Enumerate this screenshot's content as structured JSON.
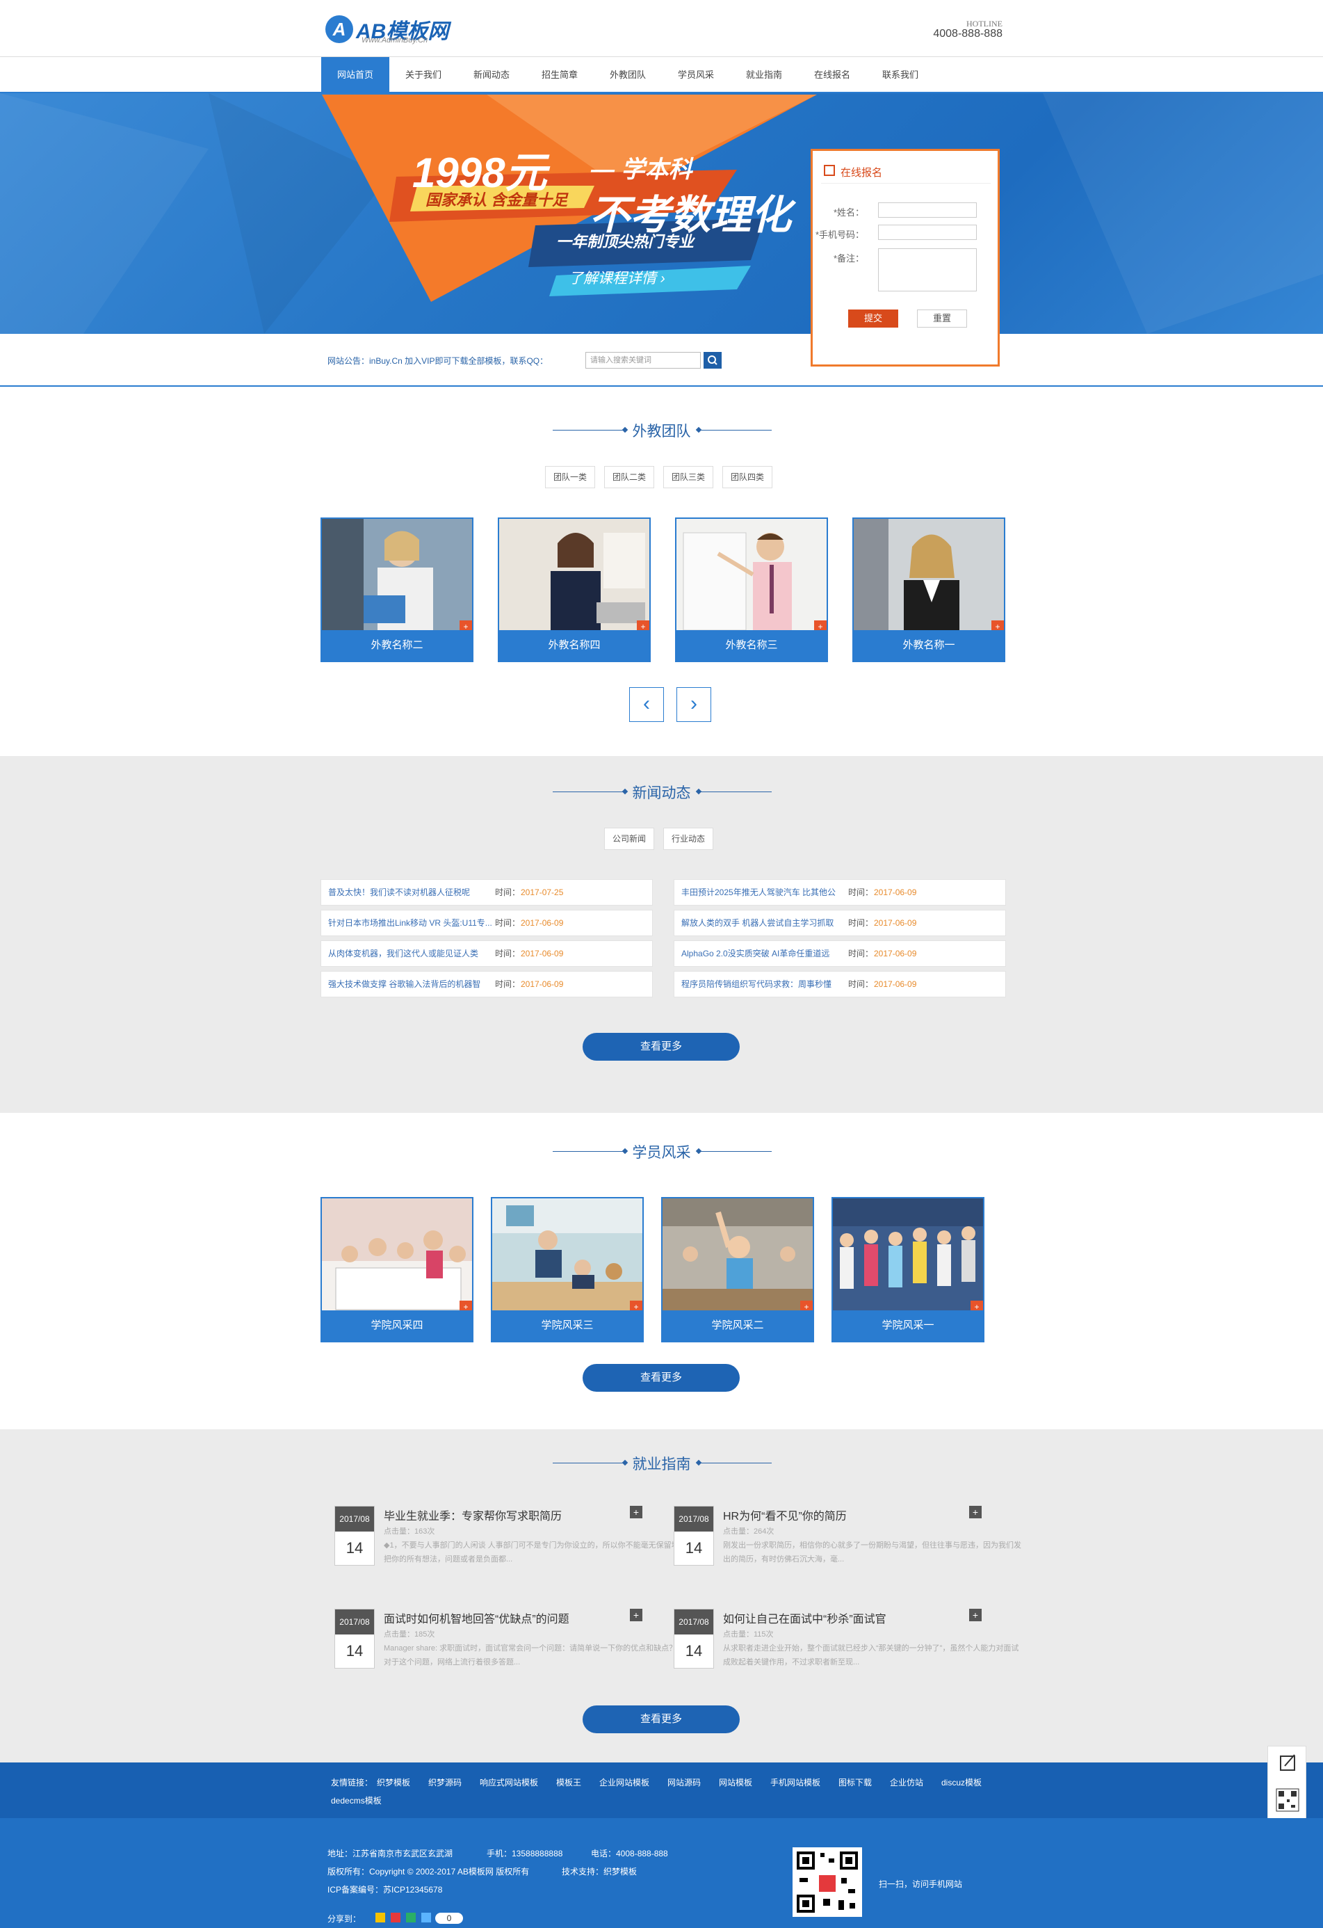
{
  "header": {
    "logo_mark": "A",
    "logo_text": "AB模板网",
    "logo_sub": "Www.AdminBuy.Cn",
    "hotline_label": "HOTLINE",
    "hotline_number": "4008-888-888"
  },
  "nav": {
    "items": [
      "网站首页",
      "关于我们",
      "新闻动态",
      "招生简章",
      "外教团队",
      "学员风采",
      "就业指南",
      "在线报名",
      "联系我们"
    ],
    "active_index": 0
  },
  "banner": {
    "title": "1998元",
    "title_suffix": "— 学本科",
    "tag": "国家承认  含金量十足",
    "headline": "不考数理化",
    "band": "一年制顶尖热门专业",
    "more": "了解课程详情 ›"
  },
  "signup_form": {
    "title": "在线报名",
    "name_label": "*姓名：",
    "phone_label": "*手机号码：",
    "note_label": "*备注：",
    "submit_label": "提交",
    "reset_label": "重置"
  },
  "notice": {
    "text": "网站公告：inBuy.Cn 加入VIP即可下载全部模板，联系QQ：",
    "search_placeholder": "请输入搜索关键词"
  },
  "teachers": {
    "title": "外教团队",
    "tabs": [
      "团队一类",
      "团队二类",
      "团队三类",
      "团队四类"
    ],
    "cards": [
      "外教名称二",
      "外教名称四",
      "外教名称三",
      "外教名称一"
    ],
    "prev_label": "‹",
    "next_label": "›"
  },
  "news": {
    "title": "新闻动态",
    "tabs": [
      "公司新闻",
      "行业动态"
    ],
    "time_label": "时间：",
    "left": [
      {
        "title": "普及太快！我们读不读对机器人征税呢",
        "date": "2017-07-25"
      },
      {
        "title": "针对日本市场推出Link移动 VR 头盔:U11专...",
        "date": "2017-06-09"
      },
      {
        "title": "从肉体变机器，我们这代人或能见证人类",
        "date": "2017-06-09"
      },
      {
        "title": "强大技术做支撑 谷歌输入法背后的机器智",
        "date": "2017-06-09"
      }
    ],
    "right": [
      {
        "title": "丰田预计2025年推无人驾驶汽车 比其他公",
        "date": "2017-06-09"
      },
      {
        "title": "解放人类的双手 机器人尝试自主学习抓取",
        "date": "2017-06-09"
      },
      {
        "title": "AlphaGo 2.0没实质突破 AI革命任重道远",
        "date": "2017-06-09"
      },
      {
        "title": "程序员陪传销组织写代码求救：周事秒懂",
        "date": "2017-06-09"
      }
    ],
    "more_label": "查看更多"
  },
  "students": {
    "title": "学员风采",
    "cards": [
      "学院风采四",
      "学院风采三",
      "学院风采二",
      "学院风采一"
    ],
    "more_label": "查看更多"
  },
  "guide": {
    "title": "就业指南",
    "items": [
      {
        "ym": "2017/08",
        "day": "14",
        "title": "毕业生就业季：专家帮你写求职简历",
        "views": "点击量：163次",
        "desc": "◆1，不要与人事部门的人闲谈 人事部门可不是专门为你设立的，所以你不能毫无保留地把你的所有想法，问题或者是负面都..."
      },
      {
        "ym": "2017/08",
        "day": "14",
        "title": "HR为何“看不见”你的简历",
        "views": "点击量：264次",
        "desc": "刚发出一份求职简历，相信你的心就多了一份期盼与渴望，但往往事与愿违，因为我们发出的简历，有时仿佛石沉大海，毫..."
      },
      {
        "ym": "2017/08",
        "day": "14",
        "title": "面试时如何机智地回答“优缺点”的问题",
        "views": "点击量：185次",
        "desc": "Manager share: 求职面试时，面试官常会问一个问题：请简单说一下你的优点和缺点？对于这个问题，网络上流行着很多答题..."
      },
      {
        "ym": "2017/08",
        "day": "14",
        "title": "如何让自己在面试中“秒杀”面试官",
        "views": "点击量：115次",
        "desc": "从求职者走进企业开始，整个面试就已经步入“那关键的一分钟了”，虽然个人能力对面试成败起着关键作用，不过求职者新至现..."
      }
    ],
    "more_label": "查看更多"
  },
  "footer": {
    "links_label": "友情链接：",
    "links": [
      "织梦模板",
      "织梦源码",
      "响应式网站模板",
      "模板王",
      "企业网站模板",
      "网站源码",
      "网站模板",
      "手机网站模板",
      "图标下载",
      "企业仿站",
      "discuz模板",
      "dedecms模板"
    ],
    "address": "地址：江苏省南京市玄武区玄武湖",
    "mobile": "手机：13588888888",
    "phone": "电话：4008-888-888",
    "copyright": "版权所有：Copyright © 2002-2017 AB模板网 版权所有",
    "support": "技术支持：织梦模板",
    "icp": "ICP备案编号：苏ICP12345678",
    "share_label": "分享到：",
    "share_count": "0",
    "qr_caption": "扫一扫，访问手机网站"
  },
  "colors": {
    "primary": "#2a7cd0",
    "accent": "#e8542a",
    "orange_date": "#e88b2c",
    "footer_dark": "#1860b2"
  }
}
